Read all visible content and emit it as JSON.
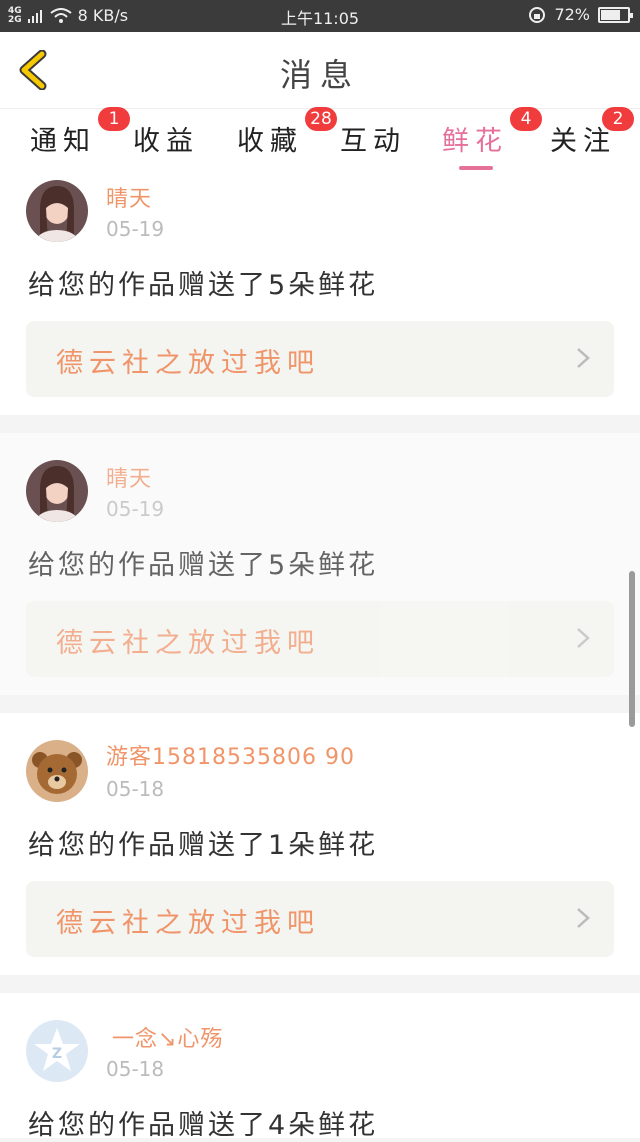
{
  "statusbar": {
    "network": "4G\n2G",
    "speed": "8 KB/s",
    "time": "上午11:05",
    "battery": "72%",
    "battery_level": 0.72
  },
  "navbar": {
    "title": "消息"
  },
  "tabs": [
    {
      "label": "通知",
      "badge": "1"
    },
    {
      "label": "收益",
      "badge": ""
    },
    {
      "label": "收藏",
      "badge": "28"
    },
    {
      "label": "互动",
      "badge": ""
    },
    {
      "label": "鲜花",
      "badge": "4"
    },
    {
      "label": "关注",
      "badge": "2"
    }
  ],
  "messages": [
    {
      "user": "晴天",
      "date": "05-19",
      "text": "给您的作品赠送了5朵鲜花",
      "work": "德云社之放过我吧",
      "avatar": "girl-avatar"
    },
    {
      "user": "晴天",
      "date": "05-19",
      "text": "给您的作品赠送了5朵鲜花",
      "work": "德云社之放过我吧",
      "avatar": "girl-avatar"
    },
    {
      "user": "游客15818535806 90",
      "date": "05-18",
      "text": "给您的作品赠送了1朵鲜花",
      "work": "德云社之放过我吧",
      "avatar": "teddy-bear-avatar"
    },
    {
      "user": "一念↘心殇",
      "date": "05-18",
      "text": "给您的作品赠送了4朵鲜花",
      "work": "",
      "avatar": "qq-default-avatar"
    }
  ],
  "colors": {
    "accent": "#e5709a",
    "name": "#f0956a",
    "badge": "#f03c3c",
    "back_arrow": "#f5c800"
  }
}
